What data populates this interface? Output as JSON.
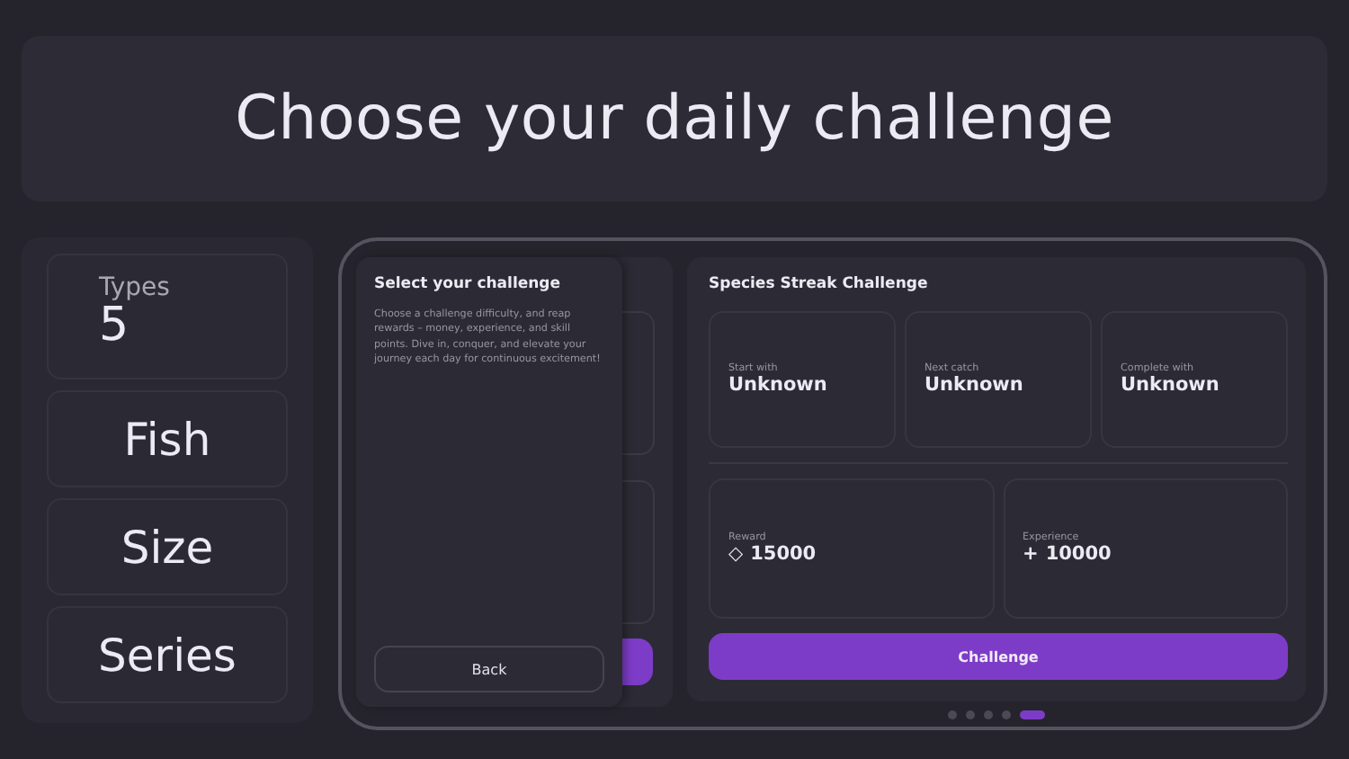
{
  "header": {
    "title": "Choose your daily challenge"
  },
  "sidebar": {
    "stat": {
      "label": "Types",
      "value": "5"
    },
    "items": [
      {
        "label": "Fish"
      },
      {
        "label": "Size"
      },
      {
        "label": "Series"
      }
    ]
  },
  "intro_panel": {
    "title": "Select your challenge",
    "text": "Choose a challenge difficulty, and reap rewards – money, experience, and skill points. Dive in, conquer, and elevate your journey each day for continuous excitement!",
    "button": "Back"
  },
  "challenge": {
    "title": "Species Streak Challenge",
    "steps": [
      {
        "label": "Start with",
        "value": "Unknown"
      },
      {
        "label": "Next catch",
        "value": "Unknown"
      },
      {
        "label": "Complete with",
        "value": "Unknown"
      }
    ],
    "rewards": [
      {
        "label": "Reward",
        "icon": "◇",
        "value": "15000"
      },
      {
        "label": "Experience",
        "icon": "+",
        "value": "10000"
      }
    ],
    "button": "Challenge"
  },
  "pager": [
    {
      "selected": false
    },
    {
      "selected": false
    },
    {
      "selected": false
    },
    {
      "selected": false
    },
    {
      "selected": true
    }
  ]
}
